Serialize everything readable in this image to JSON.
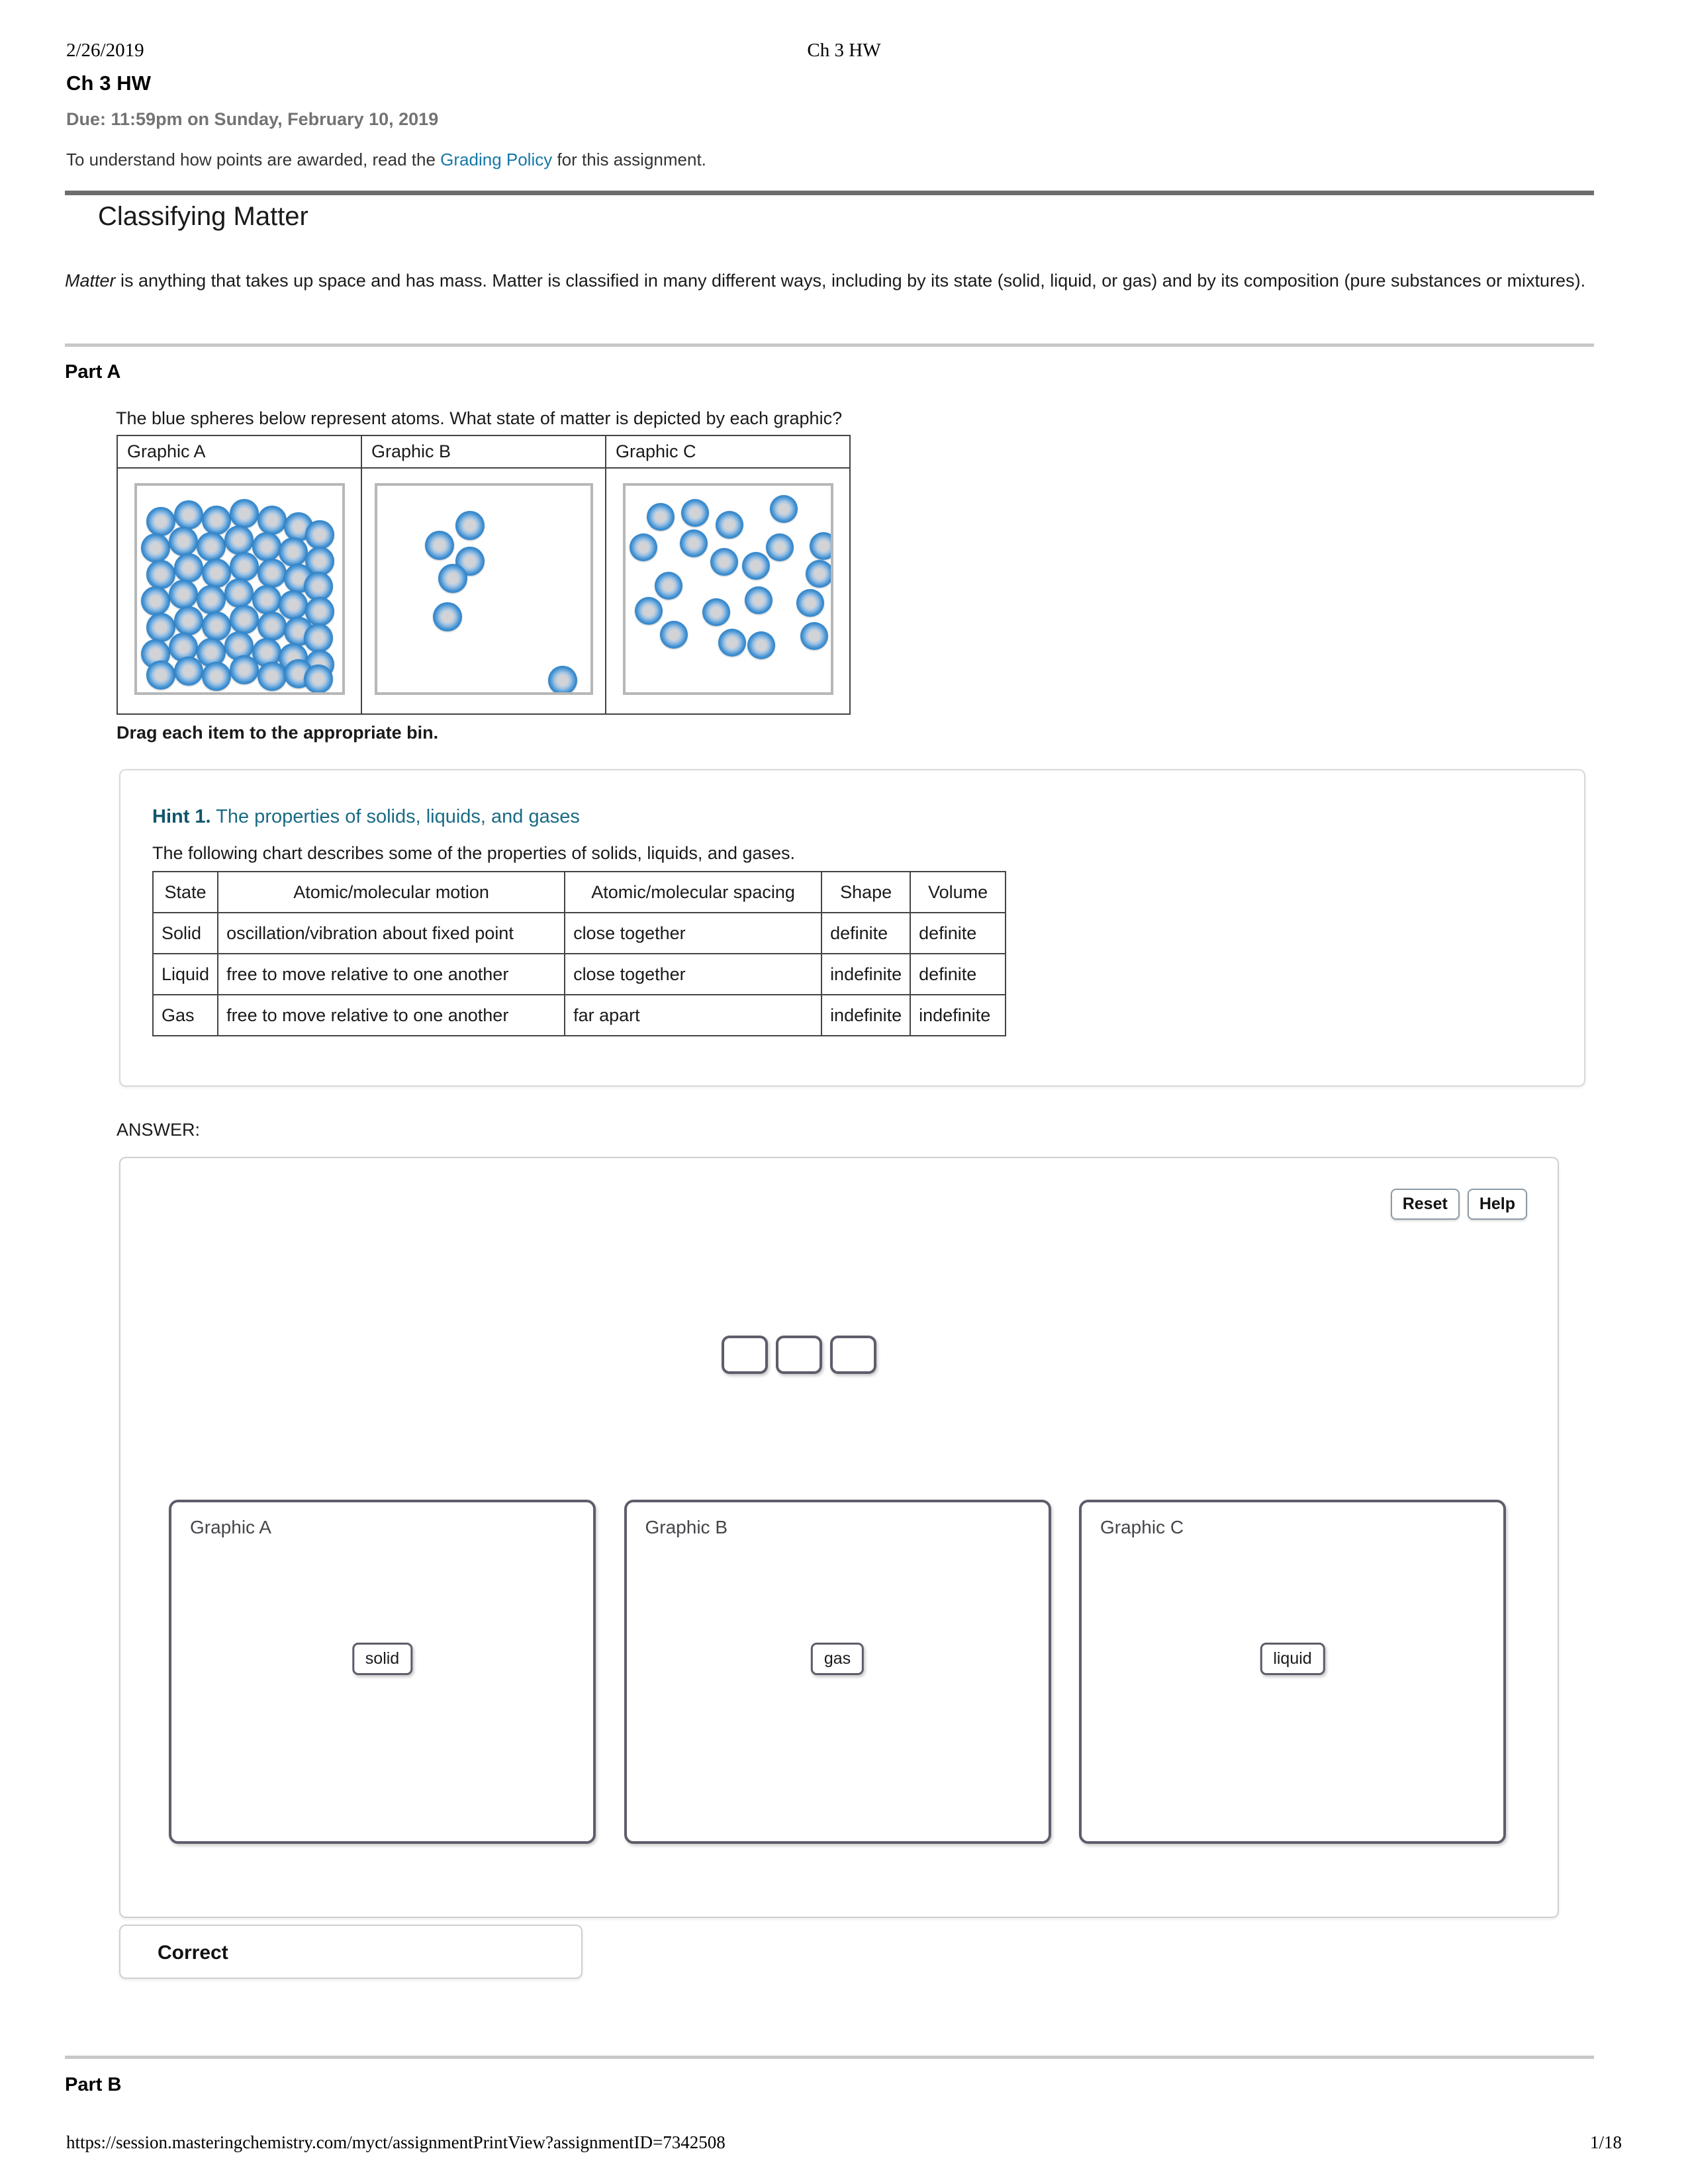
{
  "print_header": {
    "date": "2/26/2019",
    "title": "Ch 3 HW"
  },
  "assignment": {
    "title": "Ch 3 HW",
    "due": "Due: 11:59pm on Sunday, February 10, 2019",
    "grading_prefix": "To understand how points are awarded, read the ",
    "grading_link": "Grading Policy",
    "grading_suffix": " for this assignment."
  },
  "section": {
    "title": "Classifying Matter",
    "intro_em": "Matter",
    "intro_rest": " is anything that takes up space and has mass. Matter is classified in many different ways, including by its state (solid, liquid, or gas) and by its composition (pure substances or mixtures)."
  },
  "part_a": {
    "label": "Part A",
    "question": "The blue spheres below represent atoms. What state of matter is depicted by each graphic?",
    "graphics": [
      {
        "label": "Graphic A"
      },
      {
        "label": "Graphic B"
      },
      {
        "label": "Graphic C"
      }
    ],
    "drag_instruction": "Drag each item to the appropriate bin."
  },
  "hint": {
    "number": "Hint 1.",
    "title": " The properties of solids, liquids, and gases",
    "subtitle": "The following chart describes some of the properties of solids, liquids, and gases.",
    "table": {
      "headers": [
        "State",
        "Atomic/molecular motion",
        "Atomic/molecular spacing",
        "Shape",
        "Volume"
      ],
      "rows": [
        [
          "Solid",
          "oscillation/vibration about fixed point",
          "close together",
          "definite",
          "definite"
        ],
        [
          "Liquid",
          "free to move relative to one another",
          "close together",
          "indefinite",
          "definite"
        ],
        [
          "Gas",
          "free to move relative to one another",
          "far apart",
          "indefinite",
          "indefinite"
        ]
      ]
    }
  },
  "answer": {
    "label": "ANSWER:",
    "reset_label": "Reset",
    "help_label": "Help",
    "bins": [
      {
        "title": "Graphic A",
        "chip": "solid"
      },
      {
        "title": "Graphic B",
        "chip": "gas"
      },
      {
        "title": "Graphic C",
        "chip": "liquid"
      }
    ],
    "feedback": "Correct"
  },
  "part_b": {
    "label": "Part B"
  },
  "footer": {
    "url": "https://session.masteringchemistry.com/myct/assignmentPrintView?assignmentID=7342508",
    "page": "1/18"
  },
  "atom_color": "#1b72c0",
  "atoms": {
    "graphic_a": [
      [
        14,
        32,
        44
      ],
      [
        56,
        22,
        44
      ],
      [
        98,
        30,
        44
      ],
      [
        140,
        20,
        44
      ],
      [
        182,
        30,
        44
      ],
      [
        222,
        40,
        44
      ],
      [
        254,
        52,
        44
      ],
      [
        6,
        72,
        44
      ],
      [
        48,
        62,
        44
      ],
      [
        90,
        70,
        44
      ],
      [
        132,
        60,
        44
      ],
      [
        174,
        70,
        44
      ],
      [
        214,
        78,
        44
      ],
      [
        254,
        92,
        44
      ],
      [
        14,
        112,
        44
      ],
      [
        56,
        102,
        44
      ],
      [
        98,
        110,
        44
      ],
      [
        140,
        100,
        44
      ],
      [
        182,
        110,
        44
      ],
      [
        222,
        118,
        44
      ],
      [
        252,
        130,
        44
      ],
      [
        6,
        152,
        44
      ],
      [
        48,
        142,
        44
      ],
      [
        90,
        150,
        44
      ],
      [
        132,
        140,
        44
      ],
      [
        174,
        150,
        44
      ],
      [
        214,
        158,
        44
      ],
      [
        254,
        168,
        44
      ],
      [
        14,
        192,
        44
      ],
      [
        56,
        182,
        44
      ],
      [
        98,
        190,
        44
      ],
      [
        140,
        180,
        44
      ],
      [
        182,
        190,
        44
      ],
      [
        222,
        198,
        44
      ],
      [
        252,
        208,
        44
      ],
      [
        6,
        232,
        44
      ],
      [
        48,
        222,
        44
      ],
      [
        90,
        230,
        44
      ],
      [
        132,
        220,
        44
      ],
      [
        174,
        230,
        44
      ],
      [
        214,
        238,
        44
      ],
      [
        254,
        248,
        44
      ],
      [
        14,
        264,
        44
      ],
      [
        56,
        258,
        44
      ],
      [
        98,
        266,
        44
      ],
      [
        140,
        256,
        44
      ],
      [
        182,
        266,
        44
      ],
      [
        222,
        262,
        44
      ],
      [
        252,
        270,
        44
      ]
    ],
    "graphic_b": [
      [
        72,
        68,
        44
      ],
      [
        118,
        38,
        44
      ],
      [
        118,
        92,
        44
      ],
      [
        92,
        118,
        44
      ],
      [
        84,
        176,
        44
      ],
      [
        258,
        272,
        44
      ]
    ],
    "graphic_c": [
      [
        32,
        26,
        42
      ],
      [
        84,
        20,
        42
      ],
      [
        136,
        38,
        42
      ],
      [
        218,
        14,
        42
      ],
      [
        6,
        72,
        42
      ],
      [
        82,
        66,
        42
      ],
      [
        128,
        94,
        42
      ],
      [
        212,
        72,
        42
      ],
      [
        278,
        70,
        42
      ],
      [
        176,
        100,
        42
      ],
      [
        272,
        112,
        42
      ],
      [
        44,
        130,
        42
      ],
      [
        180,
        152,
        42
      ],
      [
        258,
        156,
        42
      ],
      [
        14,
        168,
        42
      ],
      [
        116,
        170,
        42
      ],
      [
        52,
        204,
        42
      ],
      [
        140,
        216,
        42
      ],
      [
        184,
        220,
        42
      ],
      [
        264,
        206,
        42
      ]
    ]
  }
}
